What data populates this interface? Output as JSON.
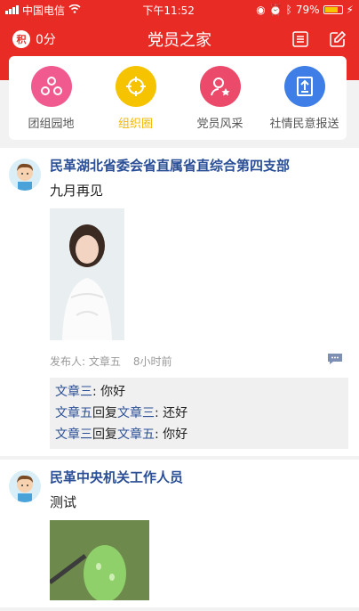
{
  "status": {
    "carrier": "中国电信",
    "time": "下午11:52",
    "battery": "79%",
    "battery_level": 0.79
  },
  "header": {
    "score_badge": "积",
    "score": "0分",
    "title": "党员之家"
  },
  "categories": [
    {
      "label": "团组园地",
      "color": "#f05a8f",
      "icon": "group-icon"
    },
    {
      "label": "组织圈",
      "color": "#f6c300",
      "icon": "circle-target-icon"
    },
    {
      "label": "党员风采",
      "color": "#ec4a6a",
      "icon": "person-star-icon"
    },
    {
      "label": "社情民意报送",
      "color": "#3e7ee6",
      "icon": "upload-doc-icon"
    }
  ],
  "posts": [
    {
      "author": "民革湖北省委会省直属省直综合第四支部",
      "text": "九月再见",
      "publisher_label": "发布人:",
      "publisher": "文章五",
      "time": "8小时前",
      "comments": [
        {
          "user": "文章三",
          "sep": ": ",
          "text": "你好"
        },
        {
          "user": "文章五",
          "reply": "回复",
          "target": "文章三",
          "sep": ": ",
          "text": "还好"
        },
        {
          "user": "文章三",
          "reply": "回复",
          "target": "文章五",
          "sep": ": ",
          "text": "你好"
        }
      ]
    },
    {
      "author": "民革中央机关工作人员",
      "text": "测试"
    }
  ]
}
